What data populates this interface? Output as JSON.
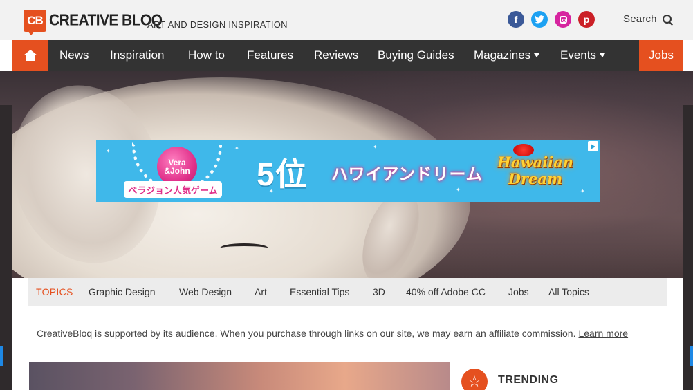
{
  "header": {
    "logo_mark": "CB",
    "logo_text": "CREATIVE BLOQ",
    "tagline": "ART AND DESIGN INSPIRATION",
    "social": [
      {
        "name": "facebook-icon",
        "glyph": "f",
        "color": "#3b5998"
      },
      {
        "name": "twitter-icon",
        "glyph": "t",
        "color": "#1da1f2"
      },
      {
        "name": "instagram-icon",
        "glyph": "",
        "color": "#d6249f"
      },
      {
        "name": "pinterest-icon",
        "glyph": "p",
        "color": "#cb2027"
      }
    ],
    "search_label": "Search"
  },
  "nav": {
    "home_icon": "home-icon",
    "items": [
      {
        "label": "News"
      },
      {
        "label": "Inspiration"
      },
      {
        "label": "How to"
      },
      {
        "label": "Features"
      },
      {
        "label": "Reviews"
      },
      {
        "label": "Buying Guides"
      },
      {
        "label": "Magazines",
        "dropdown": true
      },
      {
        "label": "Events",
        "dropdown": true
      }
    ],
    "jobs_label": "Jobs",
    "accent_color": "#e5501f",
    "bar_color": "#333333"
  },
  "ad": {
    "brand_line1": "Vera",
    "brand_line2": "&John",
    "ribbon": "ベラジョン人気ゲーム",
    "rank": "5位",
    "headline": "ハワイアンドリーム",
    "game_line1": "Hawaiian",
    "game_line2": "Dream",
    "background_color": "#3fb8ea"
  },
  "topics": {
    "label": "TOPICS",
    "items": [
      "Graphic Design",
      "Web Design",
      "Art",
      "Essential Tips",
      "3D",
      "40% off Adobe CC",
      "Jobs",
      "All Topics"
    ]
  },
  "affiliate": {
    "text": "CreativeBloq is supported by its audience. When you purchase through links on our site, we may earn an affiliate commission.",
    "link": "Learn more"
  },
  "sidebar": {
    "trending_label": "TRENDING",
    "trending_icon": "star-icon"
  }
}
